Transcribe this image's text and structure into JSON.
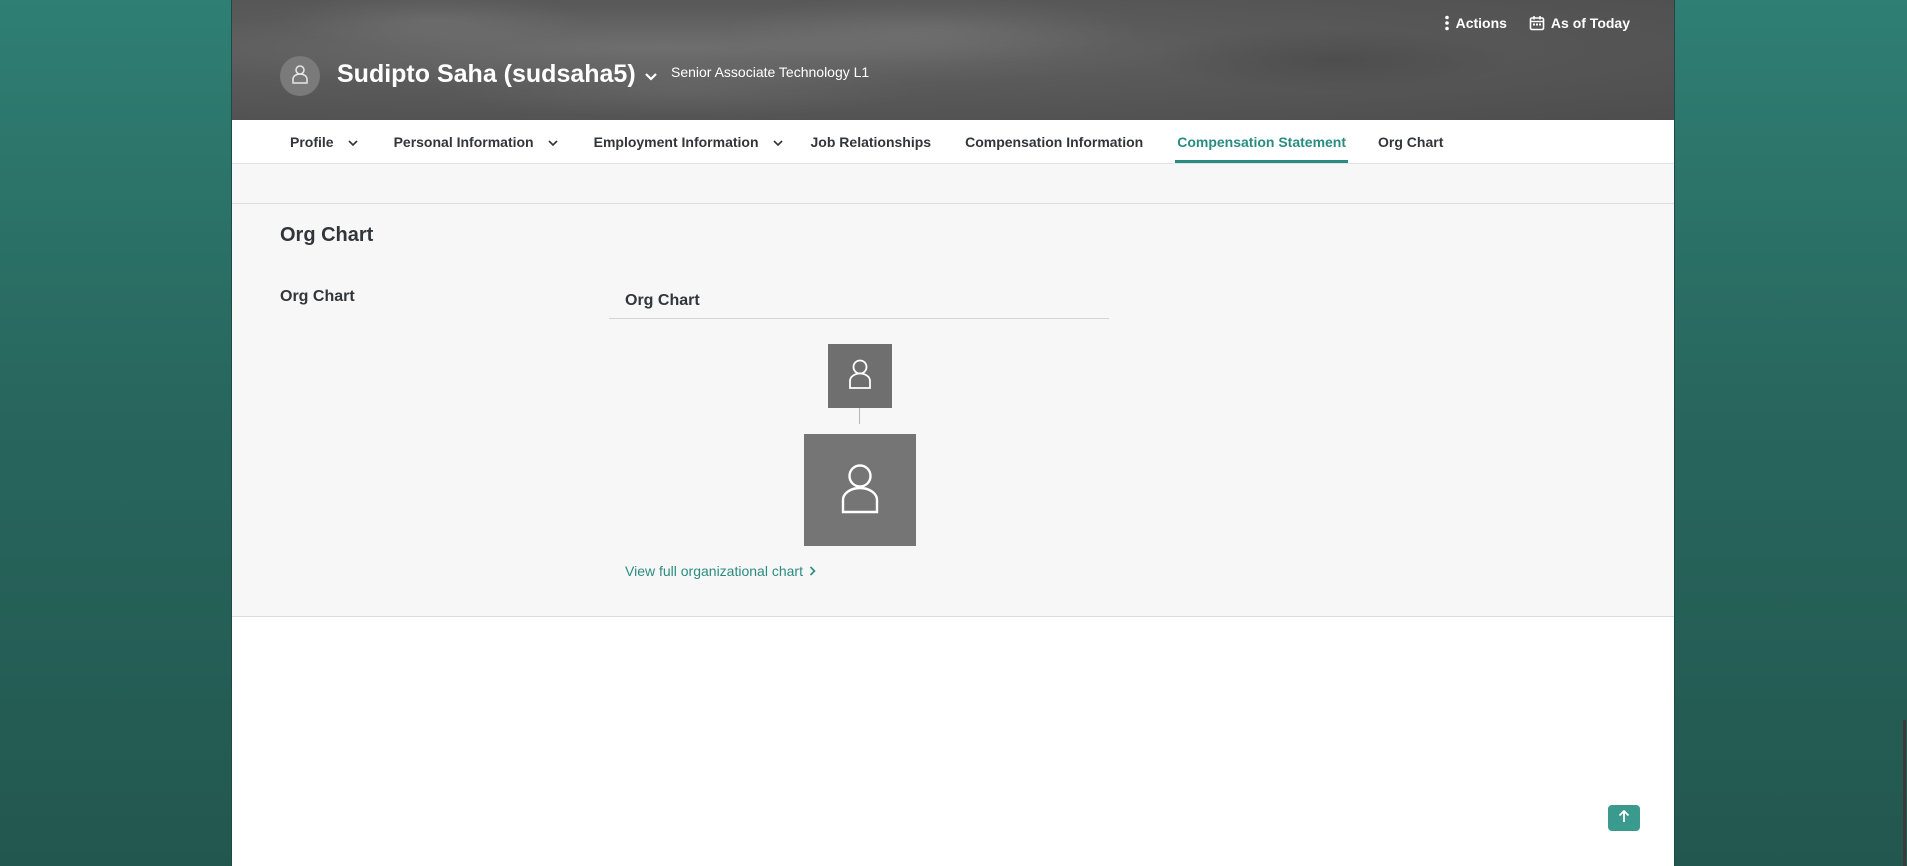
{
  "header": {
    "employee_name": "Sudipto Saha (sudsaha5)",
    "job_title": "Senior Associate Technology L1",
    "actions_label": "Actions",
    "as_of_label": "As of Today"
  },
  "tabs": [
    {
      "label": "Profile",
      "has_menu": true
    },
    {
      "label": "Personal Information",
      "has_menu": true
    },
    {
      "label": "Employment Information",
      "has_menu": true
    },
    {
      "label": "Job Relationships",
      "has_menu": false
    },
    {
      "label": "Compensation Information",
      "has_menu": false
    },
    {
      "label": "Compensation Statement",
      "has_menu": false,
      "active": true
    },
    {
      "label": "Org Chart",
      "has_menu": false
    }
  ],
  "section": {
    "title": "Org Chart",
    "field_label": "Org Chart",
    "card_title": "Org Chart",
    "view_link": "View full organizational chart"
  },
  "colors": {
    "accent": "#2a8c80",
    "background": "#2f7f74",
    "header_bg": "#5a5a5a"
  },
  "icons": {
    "avatar": "person-icon",
    "actions": "more-vertical-icon",
    "calendar": "calendar-icon",
    "scroll_top": "arrow-up-icon"
  }
}
